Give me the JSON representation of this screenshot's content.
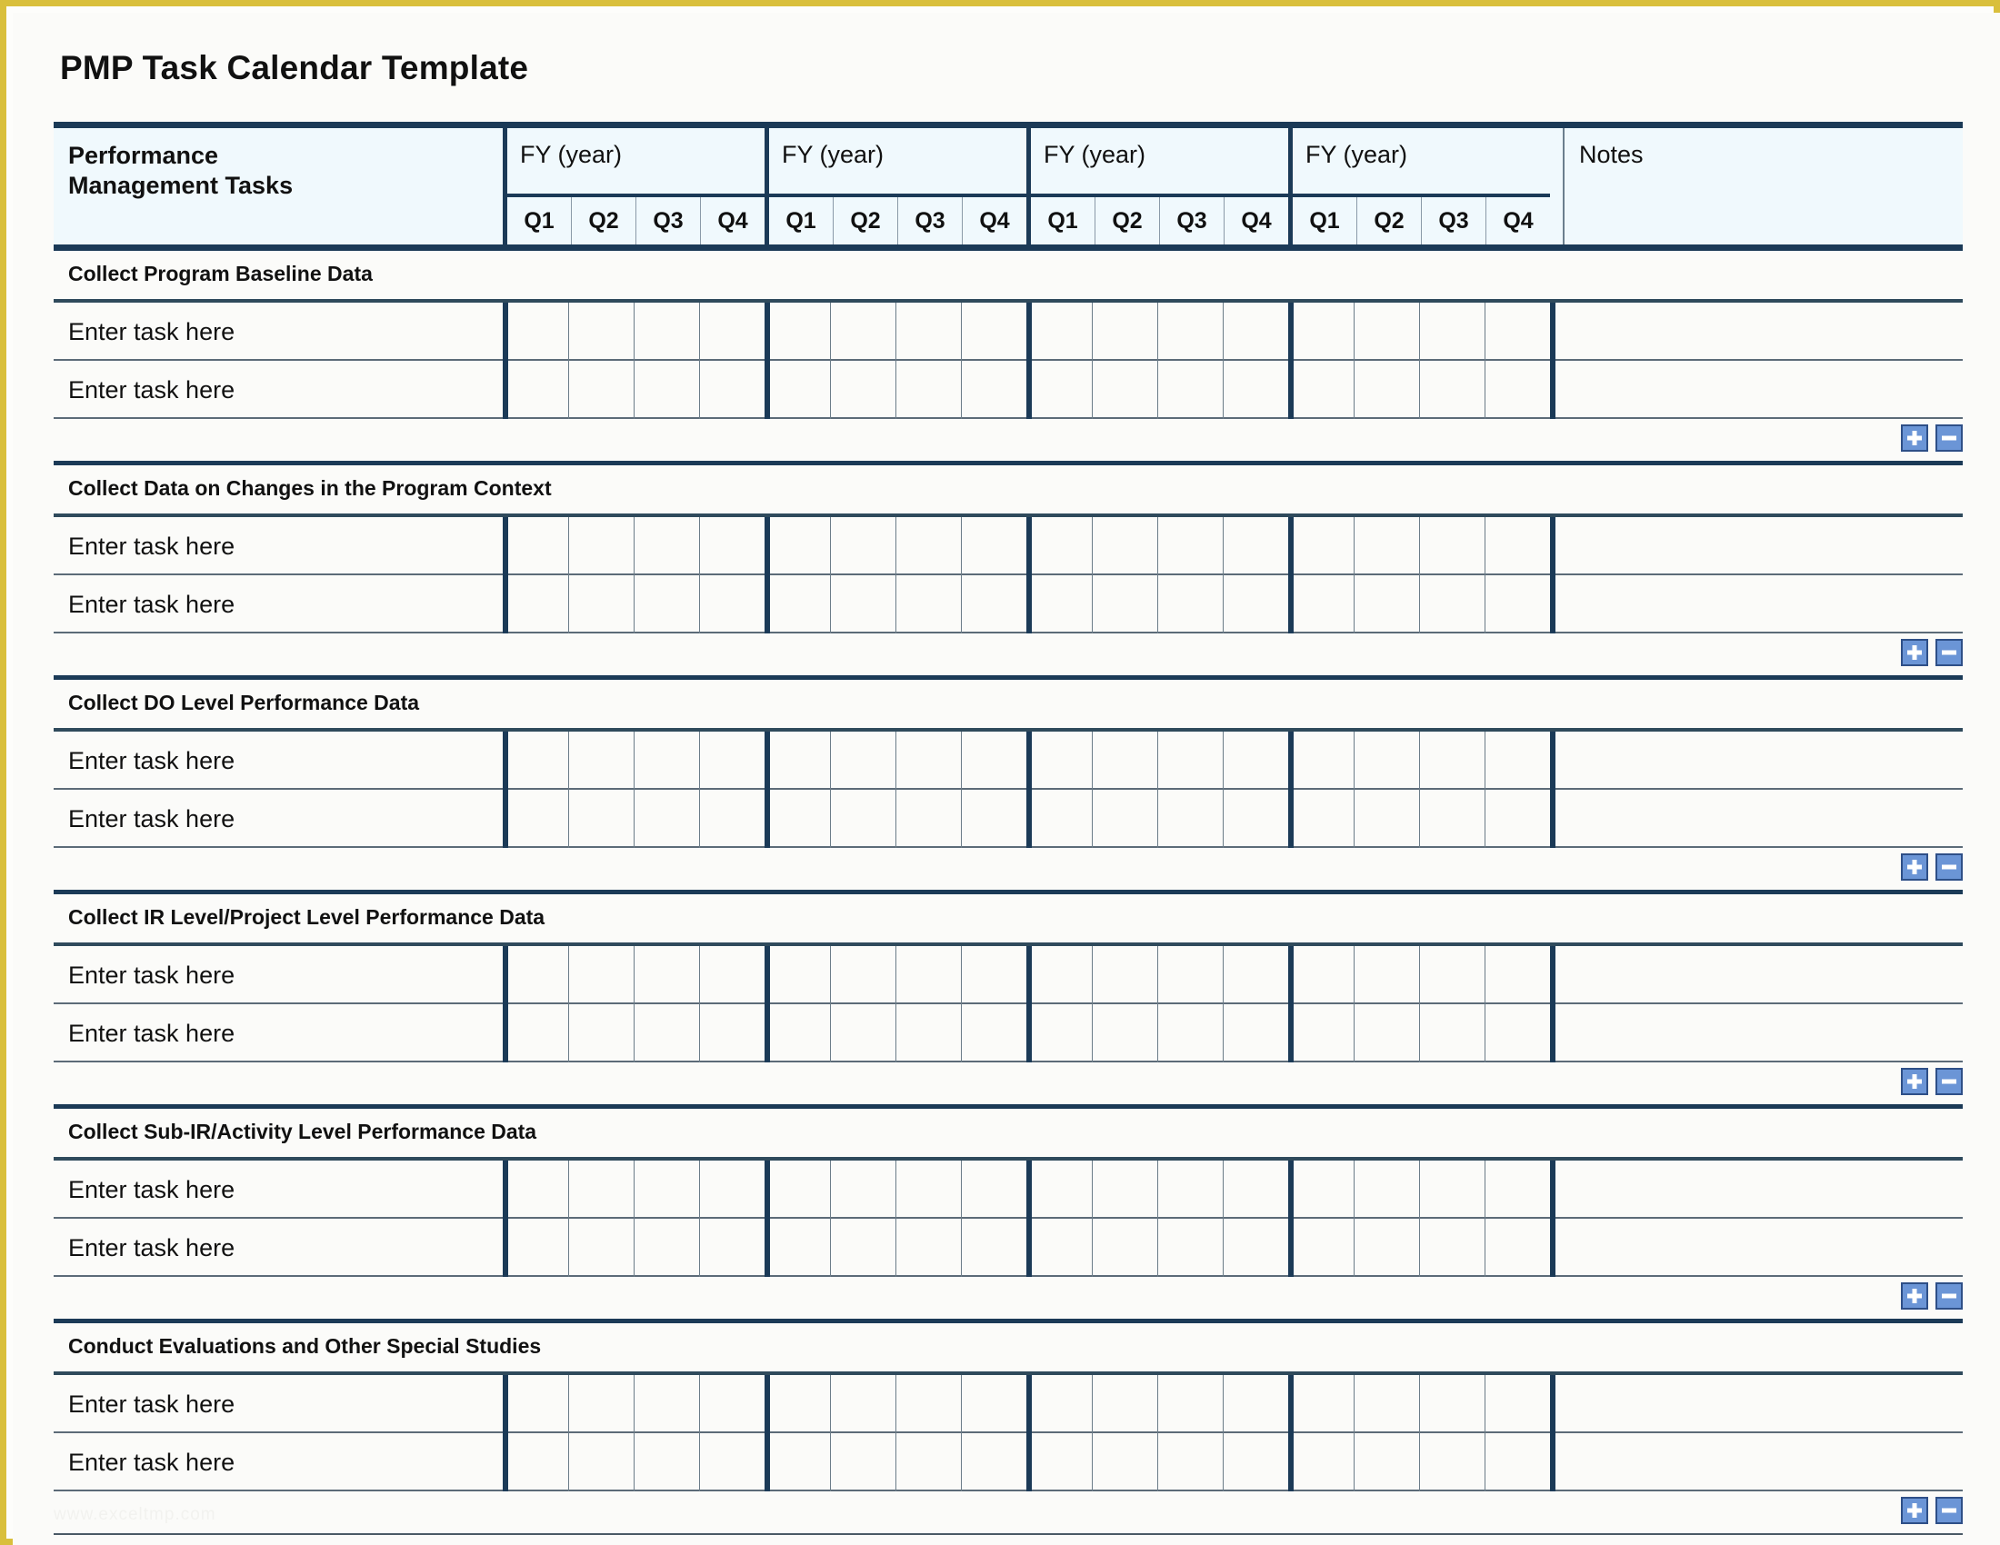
{
  "document": {
    "title": "PMP Task Calendar Template",
    "watermark": "www.exceltmp.com"
  },
  "table": {
    "tasks_header": "Performance\nManagement Tasks",
    "tasks_header_line1": "Performance",
    "tasks_header_line2": "Management Tasks",
    "notes_header": "Notes",
    "fiscal_years": [
      {
        "label": "FY  (year)",
        "quarters": [
          "Q1",
          "Q2",
          "Q3",
          "Q4"
        ]
      },
      {
        "label": "FY  (year)",
        "quarters": [
          "Q1",
          "Q2",
          "Q3",
          "Q4"
        ]
      },
      {
        "label": "FY  (year)",
        "quarters": [
          "Q1",
          "Q2",
          "Q3",
          "Q4"
        ]
      },
      {
        "label": "FY  (year)",
        "quarters": [
          "Q1",
          "Q2",
          "Q3",
          "Q4"
        ]
      }
    ],
    "sections": [
      {
        "title": "Collect Program Baseline Data",
        "rows": [
          "Enter task here",
          "Enter task here"
        ],
        "add_label": "+",
        "remove_label": "-"
      },
      {
        "title": "Collect Data on Changes in the Program Context",
        "rows": [
          "Enter task here",
          "Enter task here"
        ],
        "add_label": "+",
        "remove_label": "-"
      },
      {
        "title": "Collect DO Level Performance Data",
        "rows": [
          "Enter task here",
          "Enter task here"
        ],
        "add_label": "+",
        "remove_label": "-"
      },
      {
        "title": "Collect IR Level/Project Level Performance Data",
        "rows": [
          "Enter task here",
          "Enter task here"
        ],
        "add_label": "+",
        "remove_label": "-"
      },
      {
        "title": "Collect Sub-IR/Activity Level Performance Data",
        "rows": [
          "Enter task here",
          "Enter task here"
        ],
        "add_label": "+",
        "remove_label": "-"
      },
      {
        "title": "Conduct Evaluations and Other Special Studies",
        "rows": [
          "Enter task here",
          "Enter task here"
        ],
        "add_label": "+",
        "remove_label": "-"
      }
    ]
  },
  "colors": {
    "header_background": "#f0f9fd",
    "rule_dark": "#1b3a57",
    "page_border": "#d9bf3c",
    "button_fill": "#6b95d6",
    "button_border": "#2e4f87"
  }
}
